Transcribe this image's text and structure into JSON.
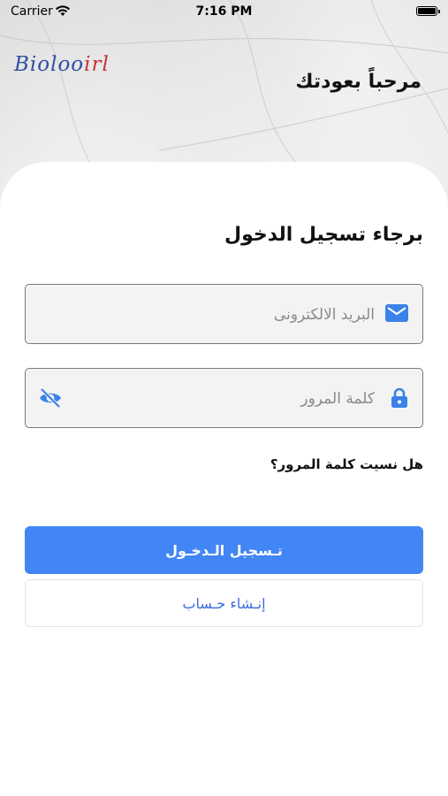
{
  "status_bar": {
    "carrier": "Carrier",
    "time": "7:16 PM"
  },
  "header": {
    "logo_part1": "Bioloo",
    "logo_part2": "irl",
    "welcome": "مرحباً بعودتك"
  },
  "login": {
    "heading": "برجاء تسجيل الدخول",
    "email_placeholder": "البريد الالكترونى",
    "password_placeholder": "كلمة المرور",
    "forgot_password": "هل نسيت كلمة المرور؟",
    "login_button": "تـسجيل الـدخـول",
    "create_account_button": "إنـشاء حـساب"
  },
  "icons": {
    "email": "envelope-icon",
    "password": "lock-icon",
    "toggle": "eye-slash-icon",
    "wifi": "wifi-icon",
    "battery": "battery-icon"
  },
  "colors": {
    "primary": "#4285F4",
    "link": "#3A6FD8",
    "icon": "#3B82E8"
  }
}
